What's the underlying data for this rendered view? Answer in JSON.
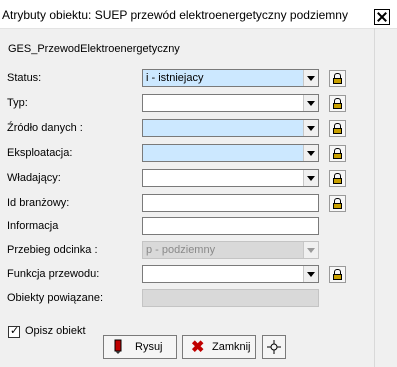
{
  "window": {
    "title": "Atrybuty obiektu: SUEP przewód elektroenergetyczny podziemny"
  },
  "object_name": "GES_PrzewodElektroenergetyczny",
  "fields": [
    {
      "label": "Status:",
      "value": "i - istniejacy"
    },
    {
      "label": "Typ:",
      "value": ""
    },
    {
      "label": "Źródło  danych :",
      "value": ""
    },
    {
      "label": "Eksploatacja:",
      "value": ""
    },
    {
      "label": "Władający:",
      "value": ""
    },
    {
      "label": "Id branżowy:",
      "value": ""
    },
    {
      "label": "Informacja",
      "value": ""
    },
    {
      "label": "Przebieg  odcinka :",
      "value": "p - podziemny"
    },
    {
      "label": "Funkcja przewodu:",
      "value": ""
    },
    {
      "label": "Obiekty powiązane:",
      "value": ""
    }
  ],
  "checkbox": {
    "label": "Opisz obiekt",
    "checked": true
  },
  "buttons": {
    "draw": "Rysuj",
    "close": "Zamknij"
  },
  "colors": {
    "highlight_field": "#cce8ff",
    "close_icon": "#c00000"
  }
}
